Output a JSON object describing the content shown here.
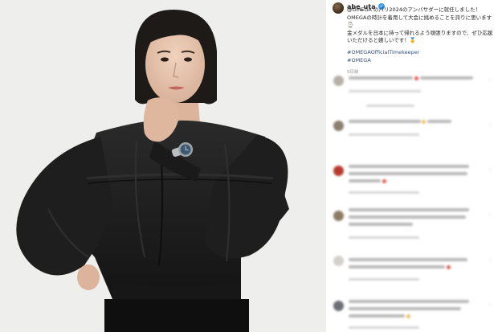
{
  "post": {
    "username": "abe_uta",
    "verified_icon": "verified-badge-icon",
    "caption_lines": [
      "@OMEGA のパリ2024のアンバサダーに就任しました！",
      "OMEGAの時計を着用して大会に挑めることを誇りに思います",
      "⌚",
      "金メダルを日本に持って帰れるよう頑張りますので、ぜひ応援",
      "いただけると嬉しいです！🏅"
    ],
    "hashtags": [
      "#OMEGAOfficialTimekeeper",
      "#OMEGA"
    ],
    "timestamp": "5日前"
  },
  "comments_blurred": 6,
  "colors": {
    "accent": "#3897f0",
    "hashtag": "#385185",
    "text": "#262626",
    "muted": "#8e8e8e",
    "photo_bg": "#ececeb",
    "outfit": "#1c1c1c"
  }
}
